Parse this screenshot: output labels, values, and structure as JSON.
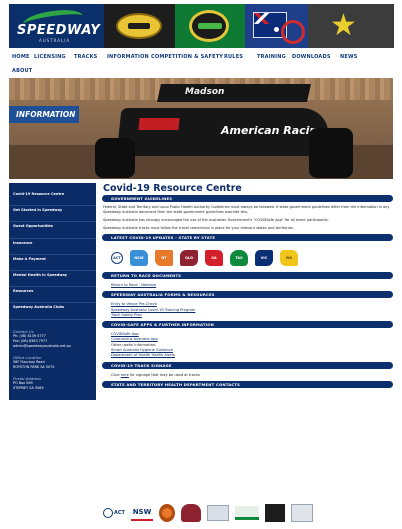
{
  "header": {
    "logo_text": "SPEEDWAY",
    "logo_subtext": "AUSTRALIA"
  },
  "nav": {
    "items": [
      "HOME",
      "LICENSING",
      "TRACKS",
      "INFORMATION",
      "COMPETITION & SAFETY",
      "RULES",
      "TRAINING",
      "DOWNLOADS",
      "NEWS",
      "ABOUT"
    ]
  },
  "hero": {
    "banner_label": "INFORMATION",
    "car_text": "American Racing",
    "wing_text": "Madson"
  },
  "sidebar": {
    "items": [
      "Covid-19 Resource Centre",
      "Get Started in Speedway",
      "Guest Opportunities",
      "Insurance",
      "Make A Payment",
      "Mental Health in Speedway",
      "Resources",
      "Speedway Australia Clubs"
    ],
    "contact": {
      "label": "Contact Us",
      "phone": "Ph: (08) 8139 0777",
      "fax": "Fax: (08) 8363 7977",
      "email": "admin@speedwayaustralia.net.au"
    },
    "office": {
      "label": "Office Location",
      "line1": "58F Flournoy Road",
      "line2": "ROYSTON PARK SA 5070"
    },
    "postal": {
      "label": "Postal Address",
      "line1": "PO Box 569",
      "line2": "STEPNEY SA 5069"
    }
  },
  "main": {
    "title": "Covid-19 Resource Centre",
    "government_guidelines": {
      "heading": "GOVERNMENT GUIDELINES",
      "paragraphs": [
        "Federal, State and Territory and Local Public Health Authority Guidelines must always be followed. If state government guidelines differ from the information in any Speedway Australia document then the state government guidelines override this.",
        "Speedway Australia has strongly encouraged the use of the Australian Government's \"COVIDSafe App\" for all event participants.",
        "Speedway Australia tracks must follow the travel restrictions in place for your relevant states and territories."
      ]
    },
    "state_updates": {
      "heading": "LATEST COVID-19 UPDATES - STATE BY STATE",
      "states": [
        "ACT",
        "NSW",
        "NT",
        "QLD",
        "SA",
        "TAS",
        "VIC",
        "WA"
      ]
    },
    "return_to_race": {
      "heading": "RETURN TO RACE DOCUMENTS",
      "links": [
        "Return to Race - National"
      ]
    },
    "forms": {
      "heading": "SPEEDWAY AUSTRALIA FORMS & RESOURCES",
      "links": [
        "Entry to Venue Pre-Check",
        "Speedway Australia Covid-19 Training Program",
        "Track Safety Plan"
      ]
    },
    "apps": {
      "heading": "COVID-SAFE APPS & FURTHER INFORMATION",
      "links_top": [
        "COVIDSafe App",
        "Coronavirus Australia App"
      ],
      "other_label": "Other useful information:",
      "links_bottom": [
        "Smart Australia Hygiene Guidance",
        "Department of Health Health Alerts"
      ]
    },
    "signage": {
      "heading": "COVID-19 TRACK SIGNAGE",
      "prefix": "Click ",
      "link": "here",
      "suffix": " for signage that may be used at tracks"
    },
    "health_departments": {
      "heading": "STATE AND TERRITORY HEALTH DEPARTMENT CONTACTS",
      "logos": [
        "ACT",
        "NSW",
        "NT",
        "QLD",
        "SA",
        "TAS",
        "VIC",
        "WA"
      ]
    }
  },
  "colors": {
    "navy": "#0a2b66",
    "bar": "#0c2f6e",
    "link": "#0d2d6a"
  }
}
